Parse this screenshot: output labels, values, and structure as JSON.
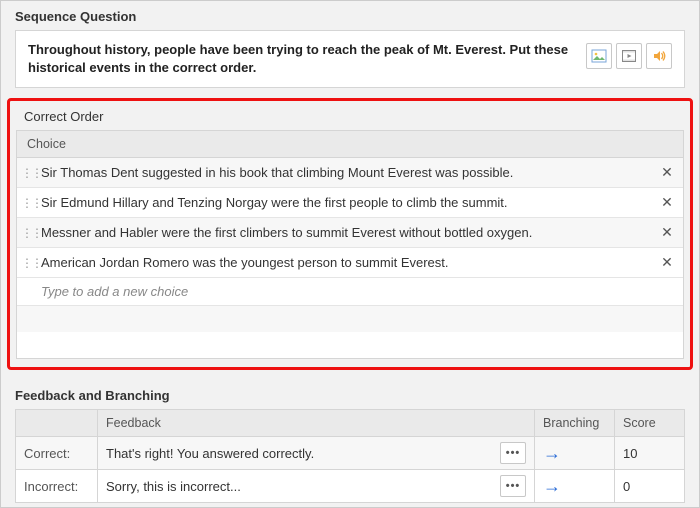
{
  "sectionTitles": {
    "question": "Sequence Question",
    "order": "Correct Order",
    "feedback": "Feedback and Branching"
  },
  "question": {
    "text": "Throughout history, people have been trying to reach the peak of Mt. Everest. Put these historical events in the correct order."
  },
  "choiceHeader": "Choice",
  "choices": [
    "Sir Thomas Dent suggested in his book that climbing Mount Everest was possible.",
    "Sir Edmund Hillary and Tenzing Norgay were the first people to climb the summit.",
    "Messner and Habler were the first climbers to summit Everest without bottled oxygen.",
    "American Jordan Romero was the youngest person to summit Everest."
  ],
  "newChoicePlaceholder": "Type to add a new choice",
  "feedbackTable": {
    "headers": {
      "blank": "",
      "feedback": "Feedback",
      "branching": "Branching",
      "score": "Score"
    },
    "rows": [
      {
        "label": "Correct:",
        "feedback": "That's right! You answered correctly.",
        "score": "10"
      },
      {
        "label": "Incorrect:",
        "feedback": "Sorry, this is incorrect...",
        "score": "0"
      }
    ]
  },
  "glyphs": {
    "remove": "✕",
    "more": "•••",
    "arrow": "→",
    "drag": "⋮⋮"
  }
}
